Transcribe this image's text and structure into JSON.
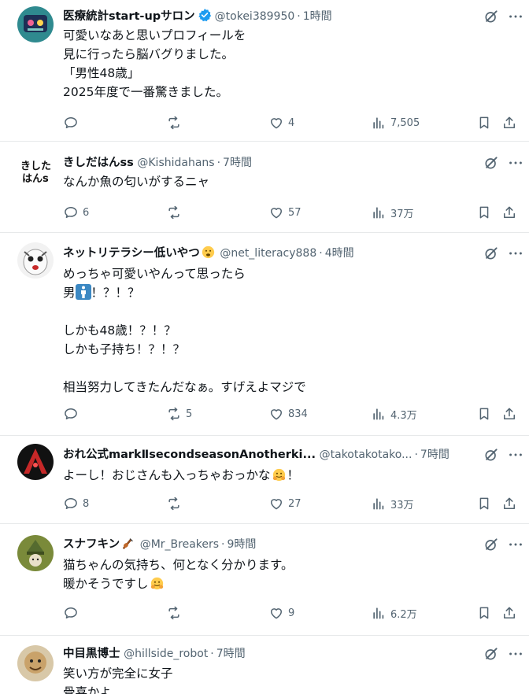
{
  "tweets": [
    {
      "name": "医療統計start-upサロン",
      "handle": "@tokei389950",
      "time": "1時間",
      "verified": true,
      "lines": [
        "可愛いなあと思いプロフィールを",
        "見に行ったら脳バグりました。",
        "「男性48歳」",
        "2025年度で一番驚きました。"
      ],
      "replies": "",
      "reposts": "",
      "likes": "4",
      "views": "7,505"
    },
    {
      "name": "きしだはんss",
      "handle": "@Kishidahans",
      "time": "7時間",
      "lines": [
        "なんか魚の匂いがするニャ"
      ],
      "replies": "6",
      "reposts": "",
      "likes": "57",
      "views": "37万"
    },
    {
      "name": "ネットリテラシー低いやつ",
      "handle": "@net_literacy888",
      "time": "4時間",
      "lines": [
        "めっちゃ可愛いやんって思ったら",
        "！？！？",
        "",
        "しかも48歳！？！？",
        "しかも子持ち！？！？",
        "",
        "相当努力してきたんだなぁ。すげえよマジで"
      ],
      "line2_prefix": "男",
      "replies": "",
      "reposts": "5",
      "likes": "834",
      "views": "4.3万"
    },
    {
      "name": "おれ公式markⅡsecondseasonAnotherki...",
      "handle": "@takotakotako...",
      "time": "7時間",
      "lines": [
        "よーし！おじさんも入っちゃおっかな",
        "！"
      ],
      "replies": "8",
      "reposts": "",
      "likes": "27",
      "views": "33万"
    },
    {
      "name": "スナフキン",
      "handle": "@Mr_Breakers",
      "time": "9時間",
      "lines": [
        "猫ちゃんの気持ち、何となく分かります。",
        "暖かそうですし"
      ],
      "replies": "",
      "reposts": "",
      "likes": "9",
      "views": "6.2万"
    },
    {
      "name": "中目黒博士",
      "handle": "@hillside_robot",
      "time": "7時間",
      "lines": [
        "笑い方が完全に女子",
        "骨喜かよ"
      ]
    }
  ],
  "colors": {
    "text": "#0f1419",
    "secondary": "#536471",
    "verified": "#1d9bf0",
    "divider": "#e7e9ea"
  },
  "icons": [
    "reply-icon",
    "repost-icon",
    "like-icon",
    "views-icon",
    "bookmark-icon",
    "share-icon",
    "grok-icon",
    "more-icon",
    "verified-badge-icon"
  ]
}
